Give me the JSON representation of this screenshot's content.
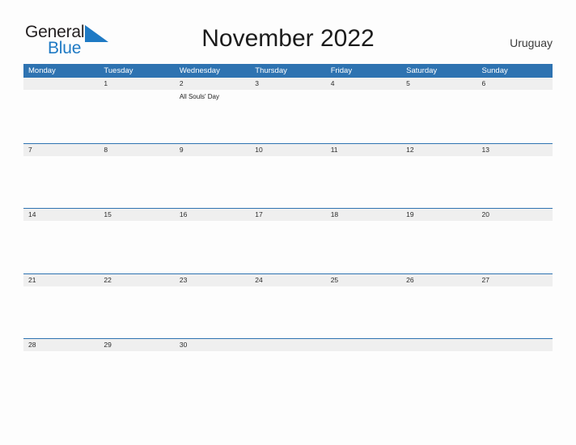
{
  "brand": {
    "name_part1": "General",
    "name_part2": "Blue",
    "flag_icon": "blue-triangle-flag-icon",
    "color_primary": "#1f7ac4",
    "color_text": "#231f20"
  },
  "header": {
    "title": "November 2022",
    "country": "Uruguay"
  },
  "calendar": {
    "header_color": "#2e73b1",
    "date_band_color": "#efefef",
    "weekdays": [
      "Monday",
      "Tuesday",
      "Wednesday",
      "Thursday",
      "Friday",
      "Saturday",
      "Sunday"
    ],
    "weeks": [
      {
        "days": [
          {
            "num": "",
            "events": []
          },
          {
            "num": "1",
            "events": []
          },
          {
            "num": "2",
            "events": [
              "All Souls' Day"
            ]
          },
          {
            "num": "3",
            "events": []
          },
          {
            "num": "4",
            "events": []
          },
          {
            "num": "5",
            "events": []
          },
          {
            "num": "6",
            "events": []
          }
        ]
      },
      {
        "days": [
          {
            "num": "7",
            "events": []
          },
          {
            "num": "8",
            "events": []
          },
          {
            "num": "9",
            "events": []
          },
          {
            "num": "10",
            "events": []
          },
          {
            "num": "11",
            "events": []
          },
          {
            "num": "12",
            "events": []
          },
          {
            "num": "13",
            "events": []
          }
        ]
      },
      {
        "days": [
          {
            "num": "14",
            "events": []
          },
          {
            "num": "15",
            "events": []
          },
          {
            "num": "16",
            "events": []
          },
          {
            "num": "17",
            "events": []
          },
          {
            "num": "18",
            "events": []
          },
          {
            "num": "19",
            "events": []
          },
          {
            "num": "20",
            "events": []
          }
        ]
      },
      {
        "days": [
          {
            "num": "21",
            "events": []
          },
          {
            "num": "22",
            "events": []
          },
          {
            "num": "23",
            "events": []
          },
          {
            "num": "24",
            "events": []
          },
          {
            "num": "25",
            "events": []
          },
          {
            "num": "26",
            "events": []
          },
          {
            "num": "27",
            "events": []
          }
        ]
      },
      {
        "days": [
          {
            "num": "28",
            "events": []
          },
          {
            "num": "29",
            "events": []
          },
          {
            "num": "30",
            "events": []
          },
          {
            "num": "",
            "events": []
          },
          {
            "num": "",
            "events": []
          },
          {
            "num": "",
            "events": []
          },
          {
            "num": "",
            "events": []
          }
        ]
      }
    ]
  }
}
